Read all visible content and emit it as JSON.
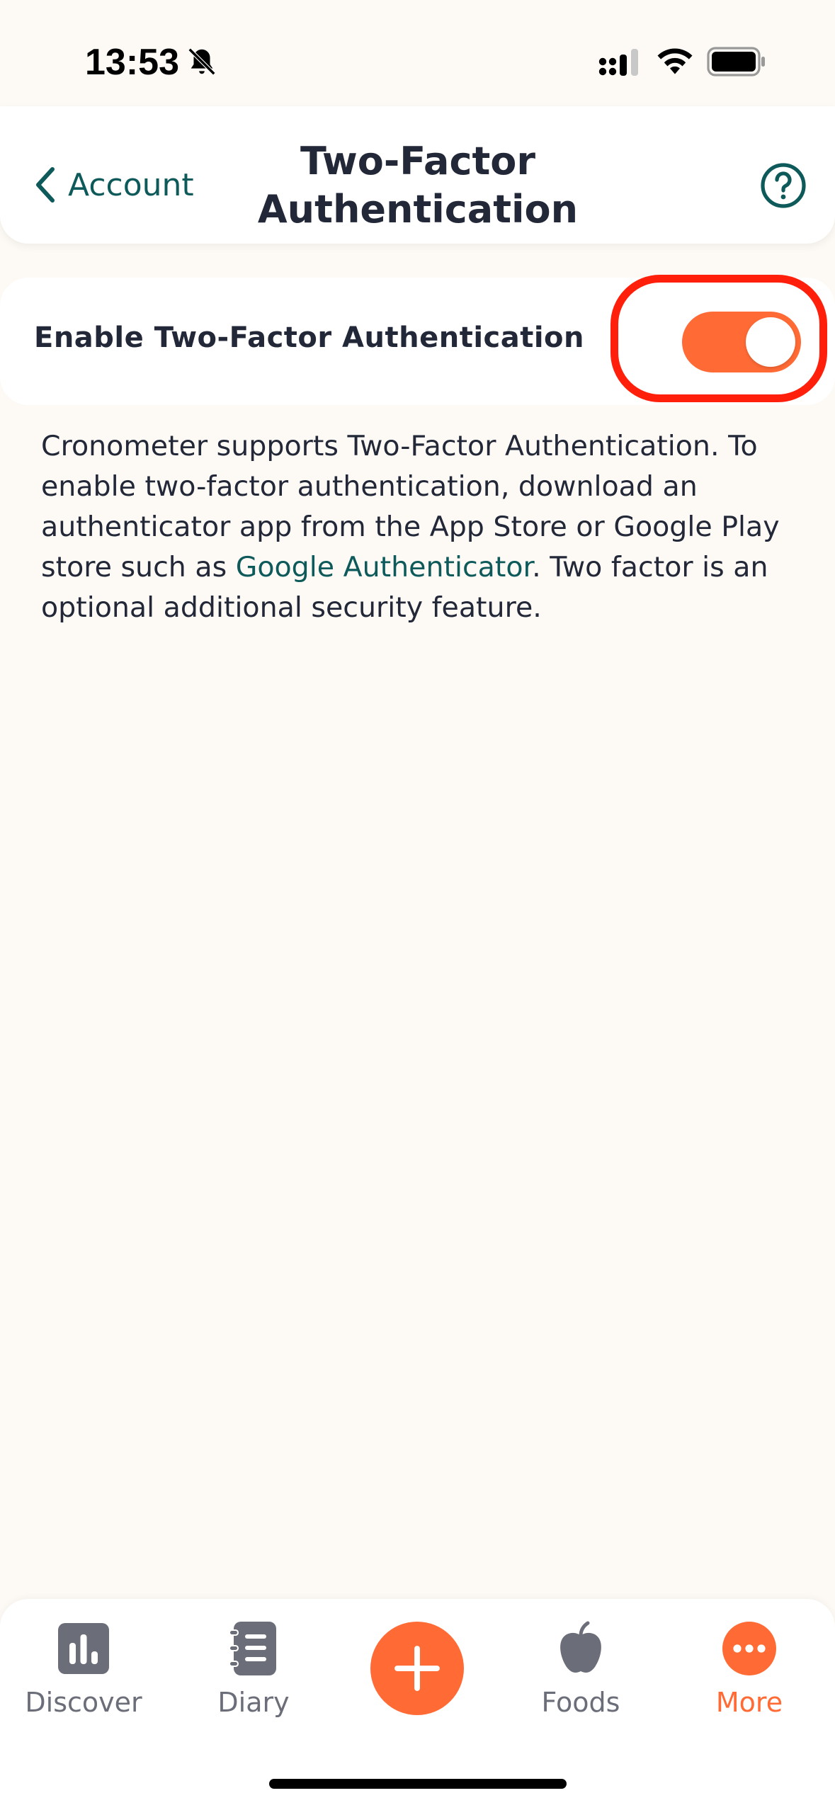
{
  "status_bar": {
    "time": "13:53",
    "icons": [
      "bell-slash-icon",
      "signal-icon",
      "wifi-icon",
      "battery-icon"
    ]
  },
  "header": {
    "back_label": "Account",
    "title": "Two-Factor Authentication",
    "help_icon": "question-circle-icon"
  },
  "setting": {
    "label": "Enable Two-Factor Authentication",
    "enabled": true
  },
  "description": {
    "text_before_link": "Cronometer supports Two-Factor Authentication. To enable two-factor authentication, download an authenticator app from the App Store or Google Play store such as ",
    "link_text": "Google Authenticator",
    "text_after_link": ". Two factor is an optional additional security feature."
  },
  "bottom_nav": {
    "items": [
      {
        "label": "Discover",
        "icon": "bar-chart-icon"
      },
      {
        "label": "Diary",
        "icon": "notebook-icon"
      },
      {
        "label": "Foods",
        "icon": "apple-icon"
      },
      {
        "label": "More",
        "icon": "more-dots-icon"
      }
    ],
    "active": "More",
    "add_icon": "plus-icon"
  },
  "colors": {
    "accent": "#FF6A35",
    "teal": "#0E5A5B",
    "highlight": "#FF1F0B",
    "background": "#FDFAF5"
  }
}
